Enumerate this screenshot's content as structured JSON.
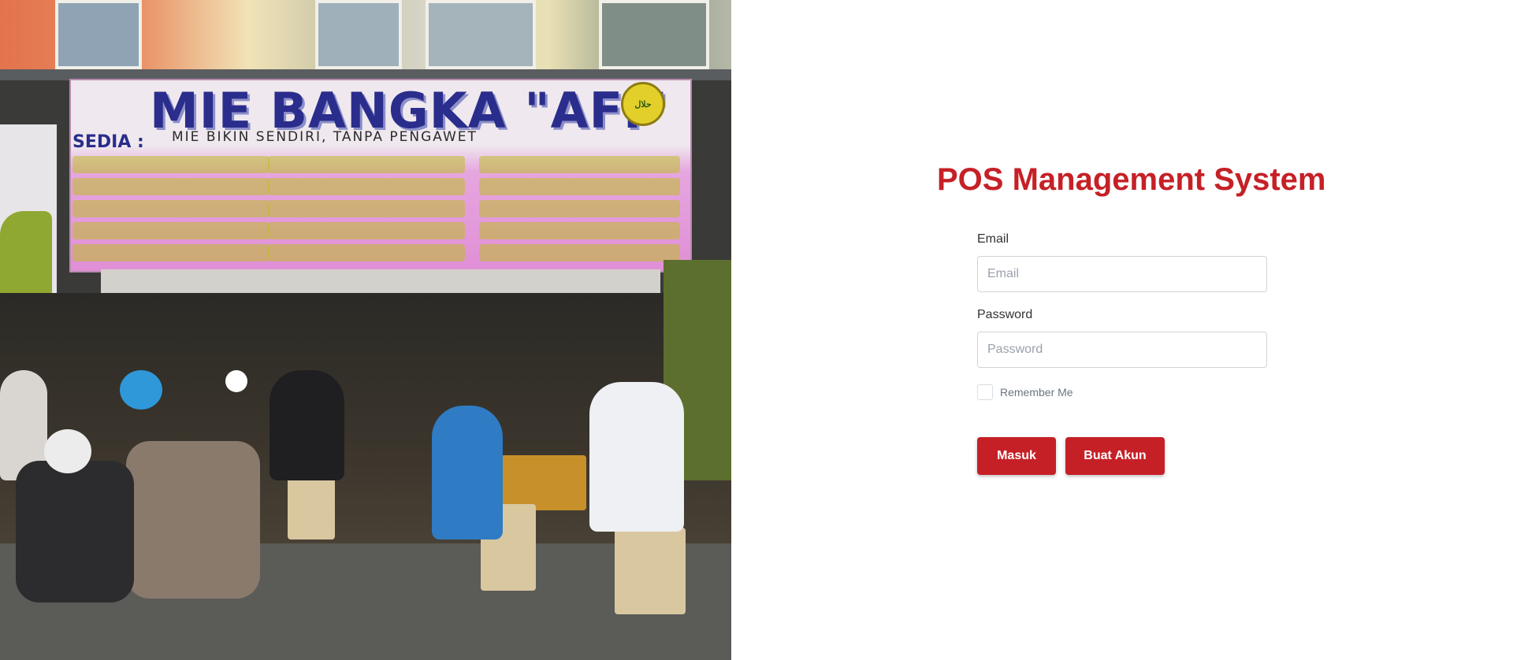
{
  "hero_photo": {
    "banner_title": "MIE BANGKA \"AFI\"",
    "banner_subtitle": "MIE BIKIN SENDIRI, TANPA PENGAWET",
    "banner_sedia": "SEDIA :",
    "halal_badge": "حلال"
  },
  "login": {
    "title": "POS Management System",
    "email": {
      "label": "Email",
      "placeholder": "Email",
      "value": ""
    },
    "password": {
      "label": "Password",
      "placeholder": "Password",
      "value": ""
    },
    "remember_label": "Remember Me",
    "remember_checked": false,
    "submit_label": "Masuk",
    "register_label": "Buat Akun"
  },
  "colors": {
    "accent": "#c62027",
    "text": "#333333",
    "muted": "#6b7580",
    "border": "#cfd4da"
  }
}
